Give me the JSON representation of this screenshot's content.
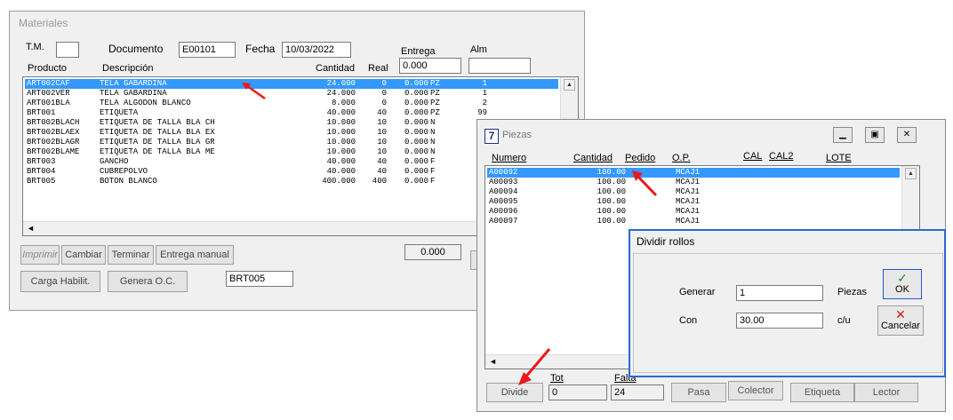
{
  "materiales": {
    "title": "Materiales",
    "tm_label": "T.M.",
    "tm_value": "",
    "documento_label": "Documento",
    "documento_value": "E00101",
    "fecha_label": "Fecha",
    "fecha_value": "10/03/2022",
    "entrega_label": "Entrega",
    "entrega_value": "0.000",
    "alm_label": "Alm",
    "alm_value": "",
    "columns": [
      "Producto",
      "Descripción",
      "Cantidad",
      "Real"
    ],
    "rows": [
      [
        "ART002CAF",
        "TELA GABARDINA",
        "24.000",
        "0",
        "0.000",
        "PZ",
        "1"
      ],
      [
        "ART002VER",
        "TELA GABARDINA",
        "24.000",
        "0",
        "0.000",
        "PZ",
        "1"
      ],
      [
        "ART001BLA",
        "TELA ALGODON BLANCO",
        "8.000",
        "0",
        "0.000",
        "PZ",
        "2"
      ],
      [
        "BRT001",
        "ETIQUETA",
        "40.000",
        "40",
        "0.000",
        "PZ",
        "99"
      ],
      [
        "BRT002BLACH",
        "ETIQUETA DE TALLA BLA CH",
        "10.000",
        "10",
        "0.000",
        "N",
        ""
      ],
      [
        "BRT002BLAEX",
        "ETIQUETA DE TALLA BLA EX",
        "10.000",
        "10",
        "0.000",
        "N",
        ""
      ],
      [
        "BRT002BLAGR",
        "ETIQUETA DE TALLA BLA GR",
        "10.000",
        "10",
        "0.000",
        "N",
        ""
      ],
      [
        "BRT002BLAME",
        "ETIQUETA DE TALLA BLA ME",
        "10.000",
        "10",
        "0.000",
        "N",
        ""
      ],
      [
        "BRT003",
        "GANCHO",
        "40.000",
        "40",
        "0.000",
        "F",
        ""
      ],
      [
        "BRT004",
        "CUBREPOLVO",
        "40.000",
        "40",
        "0.000",
        "F",
        ""
      ],
      [
        "BRT005",
        "BOTON BLANCO",
        "400.000",
        "400",
        "0.000",
        "F",
        ""
      ]
    ],
    "buttons": {
      "imprimir": "Imprimir",
      "cambiar": "Cambiar",
      "terminar": "Terminar",
      "entrega_manual": "Entrega manual",
      "carga_habilit": "Carga Habilit.",
      "genera_oc": "Genera O.C."
    },
    "total_value": "0.000",
    "selected_product": "BRT005"
  },
  "piezas": {
    "title": "Piezas",
    "icon_text": "7",
    "columns": [
      "Numero",
      "Cantidad",
      "Pedido",
      "O.P.",
      "CAL",
      "CAL2",
      "LOTE"
    ],
    "rows": [
      [
        "A00092",
        "100.00",
        "MCAJ1"
      ],
      [
        "A00093",
        "100.00",
        "MCAJ1"
      ],
      [
        "A00094",
        "100.00",
        "MCAJ1"
      ],
      [
        "A00095",
        "100.00",
        "MCAJ1"
      ],
      [
        "A00096",
        "100.00",
        "MCAJ1"
      ],
      [
        "A00097",
        "100.00",
        "MCAJ1"
      ]
    ],
    "tot_label": "Tot",
    "tot_value": "0",
    "falta_label": "Falta",
    "falta_value": "24",
    "buttons": {
      "divide": "Divide",
      "pasa": "Pasa",
      "colector": "Colector",
      "etiqueta": "Etiqueta",
      "lector": "Lector"
    }
  },
  "dividir": {
    "title": "Dividir rollos",
    "generar_label": "Generar",
    "generar_value": "1",
    "piezas_label": "Piezas",
    "con_label": "Con",
    "con_value": "30.00",
    "cu_label": "c/u",
    "ok_label": "OK",
    "cancelar_label": "Cancelar"
  },
  "colors": {
    "selection": "#3399ff",
    "arrow": "#e8191b",
    "ok_check": "#2a8a2a",
    "cancel_x": "#d01818"
  }
}
